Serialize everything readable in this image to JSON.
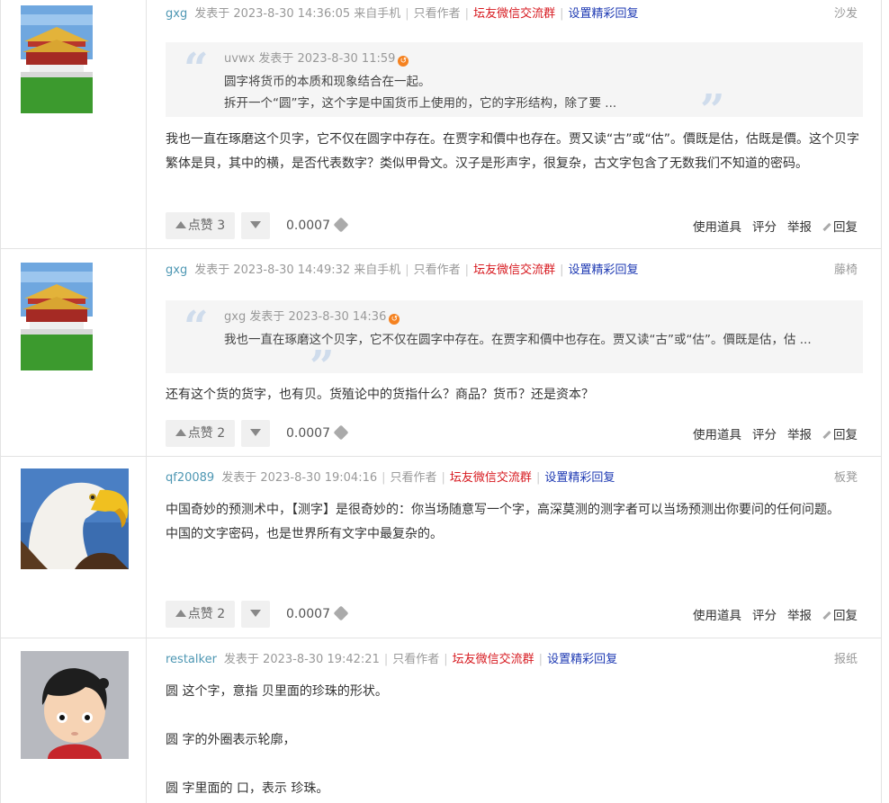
{
  "posts": [
    {
      "author": "gxg",
      "posted": "发表于 2023-8-30 14:36:05 来自手机",
      "only_author": "只看作者",
      "wechat_group": "坛友微信交流群",
      "set_featured": "设置精彩回复",
      "floor": "沙发",
      "quote": {
        "head": "uvwx 发表于 2023-8-30 11:59",
        "lines": [
          "圆字将货币的本质和现象结合在一起。",
          "拆开一个“圆”字，这个字是中国货币上使用的，它的字形结构，除了要 ..."
        ]
      },
      "content": [
        "我也一直在琢磨这个贝字，它不仅在圆字中存在。在贾字和價中也存在。贾又读“古”或“估”。價既是估，估既是價。这个贝字繁体是貝，其中的横，是否代表数字？类似甲骨文。汉子是形声字，很复杂，古文字包含了无数我们不知道的密码。"
      ],
      "like_label": "点赞",
      "like_count": "3",
      "score": "0.0007",
      "tools": {
        "use_item": "使用道具",
        "rate": "评分",
        "report": "举报",
        "reply": "回复"
      }
    },
    {
      "author": "gxg",
      "posted": "发表于 2023-8-30 14:49:32 来自手机",
      "only_author": "只看作者",
      "wechat_group": "坛友微信交流群",
      "set_featured": "设置精彩回复",
      "floor": "藤椅",
      "quote": {
        "head": "gxg 发表于 2023-8-30 14:36",
        "lines": [
          "我也一直在琢磨这个贝字，它不仅在圆字中存在。在贾字和價中也存在。贾又读“古”或“估”。價既是估，估 ..."
        ]
      },
      "content": [
        "还有这个货的货字，也有贝。货殖论中的货指什么？商品？货币？还是资本？"
      ],
      "like_label": "点赞",
      "like_count": "2",
      "score": "0.0007",
      "tools": {
        "use_item": "使用道具",
        "rate": "评分",
        "report": "举报",
        "reply": "回复"
      }
    },
    {
      "author": "qf20089",
      "posted": "发表于 2023-8-30 19:04:16",
      "only_author": "只看作者",
      "wechat_group": "坛友微信交流群",
      "set_featured": "设置精彩回复",
      "floor": "板凳",
      "content": [
        "中国奇妙的预测术中，【测字】是很奇妙的：你当场随意写一个字，高深莫测的测字者可以当场预测出你要问的任何问题。",
        "中国的文字密码，也是世界所有文字中最复杂的。"
      ],
      "like_label": "点赞",
      "like_count": "2",
      "score": "0.0007",
      "tools": {
        "use_item": "使用道具",
        "rate": "评分",
        "report": "举报",
        "reply": "回复"
      }
    },
    {
      "author": "restalker",
      "posted": "发表于 2023-8-30 19:42:21",
      "only_author": "只看作者",
      "wechat_group": "坛友微信交流群",
      "set_featured": "设置精彩回复",
      "floor": "报纸",
      "content": [
        "圆 这个字，意指 贝里面的珍珠的形状。",
        "圆 字的外圈表示轮廓，",
        "圆 字里面的 口，表示 珍珠。"
      ]
    }
  ]
}
